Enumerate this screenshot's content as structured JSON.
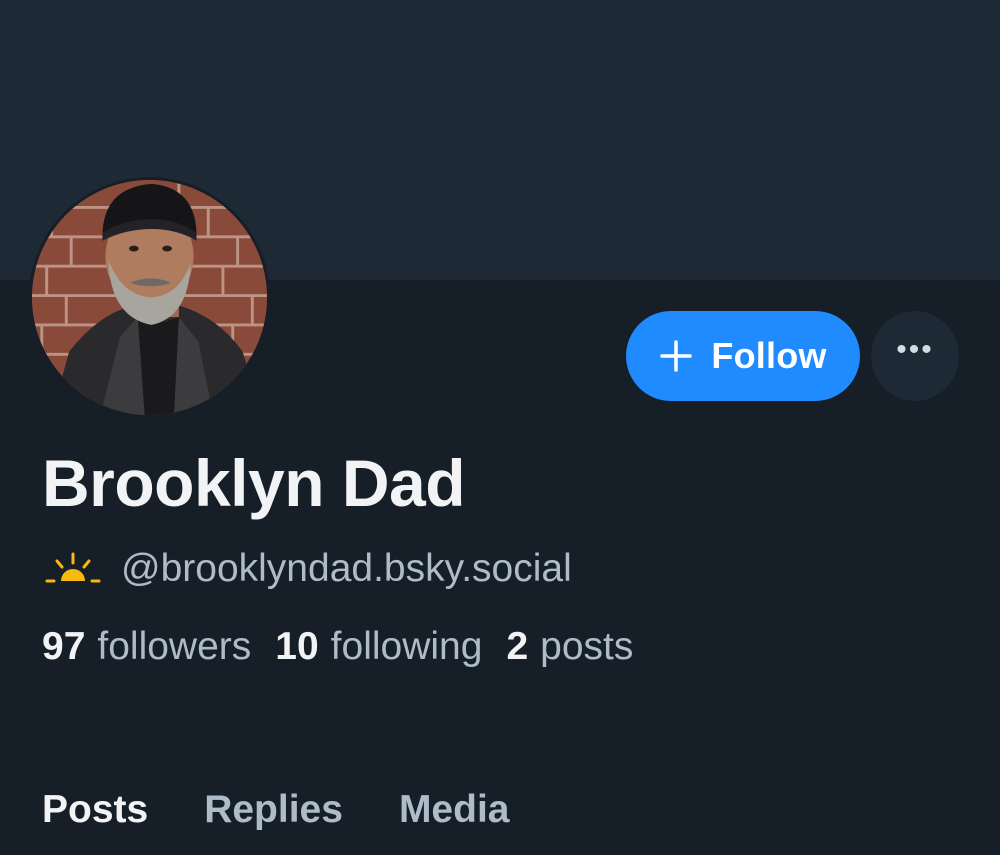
{
  "profile": {
    "display_name": "Brooklyn Dad",
    "handle": "@brooklyndad.bsky.social",
    "handle_icon": "sunrise-icon",
    "avatar_icon": "profile-avatar"
  },
  "actions": {
    "follow_label": "Follow",
    "follow_icon": "plus-icon",
    "more_label": "•••",
    "more_icon": "ellipsis-icon"
  },
  "stats": {
    "followers_count": "97",
    "followers_label": "followers",
    "following_count": "10",
    "following_label": "following",
    "posts_count": "2",
    "posts_label": "posts"
  },
  "tabs": [
    {
      "label": "Posts",
      "active": true
    },
    {
      "label": "Replies",
      "active": false
    },
    {
      "label": "Media",
      "active": false
    }
  ],
  "colors": {
    "background": "#161e27",
    "banner": "#1e2936",
    "accent": "#208bfe",
    "text_primary": "#f1f3f5",
    "text_secondary": "#aebbc9",
    "sun_yellow": "#f7b90f"
  }
}
